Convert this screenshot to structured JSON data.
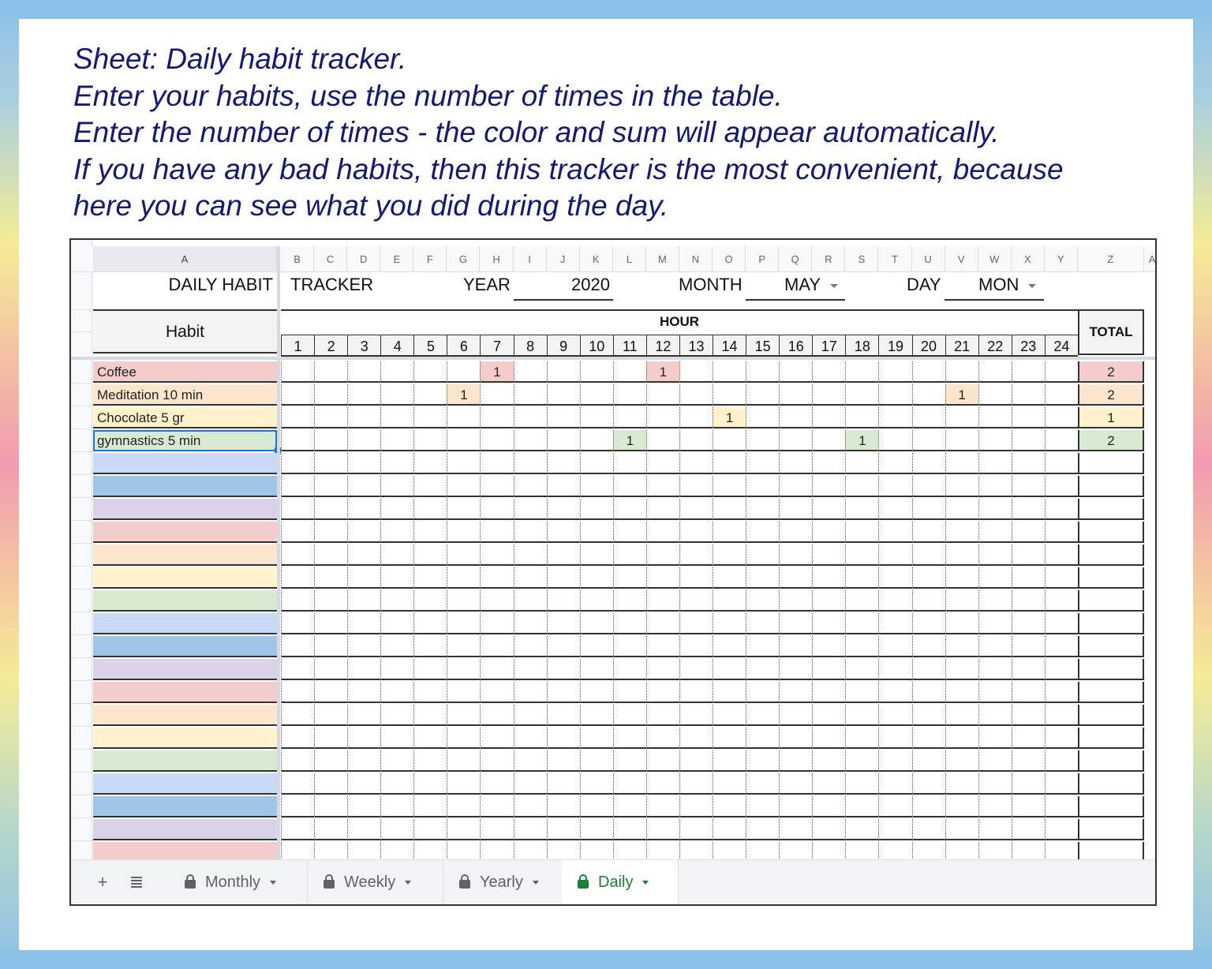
{
  "intro": {
    "lines": [
      "Sheet: Daily habit tracker.",
      "Enter your habits, use the number of times in the table.",
      "Enter the number of times - the color and sum will appear automatically.",
      "If you have any bad habits, then this tracker is the most convenient, because",
      "here you can see what you did during the day."
    ]
  },
  "columns": [
    "A",
    "B",
    "C",
    "D",
    "E",
    "F",
    "G",
    "H",
    "I",
    "J",
    "K",
    "L",
    "M",
    "N",
    "O",
    "P",
    "Q",
    "R",
    "S",
    "T",
    "U",
    "V",
    "W",
    "X",
    "Y",
    "Z",
    "AA"
  ],
  "header": {
    "title_left": "DAILY HABIT",
    "title_right": "TRACKER",
    "year_label": "YEAR",
    "year_value": "2020",
    "month_label": "MONTH",
    "month_value": "MAY",
    "day_label": "DAY",
    "day_value": "MON"
  },
  "table": {
    "habit_header": "Habit",
    "hour_header": "HOUR",
    "total_header": "TOTAL",
    "hours": [
      "1",
      "2",
      "3",
      "4",
      "5",
      "6",
      "7",
      "8",
      "9",
      "10",
      "11",
      "12",
      "13",
      "14",
      "15",
      "16",
      "17",
      "18",
      "19",
      "20",
      "21",
      "22",
      "23",
      "24"
    ],
    "habits": [
      {
        "name": "Coffee",
        "color": "#f4cccc",
        "marks": {
          "7": "1",
          "12": "1"
        },
        "total": "2"
      },
      {
        "name": "Meditation 10 min",
        "color": "#fce5cd",
        "marks": {
          "6": "1",
          "21": "1"
        },
        "total": "2"
      },
      {
        "name": "Chocolate 5 gr",
        "color": "#fff2cc",
        "marks": {
          "14": "1"
        },
        "total": "1"
      },
      {
        "name": "gymnastics 5 min",
        "color": "#d9ead3",
        "marks": {
          "11": "1",
          "18": "1"
        },
        "total": "2",
        "selected": true
      },
      {
        "name": "",
        "color": "#c9daf8"
      },
      {
        "name": "",
        "color": "#9fc5e8"
      },
      {
        "name": "",
        "color": "#d9d2e9"
      },
      {
        "name": "",
        "color": "#f4cccc"
      },
      {
        "name": "",
        "color": "#fce5cd"
      },
      {
        "name": "",
        "color": "#fff2cc"
      },
      {
        "name": "",
        "color": "#d9ead3"
      },
      {
        "name": "",
        "color": "#c9daf8"
      },
      {
        "name": "",
        "color": "#9fc5e8"
      },
      {
        "name": "",
        "color": "#d9d2e9"
      },
      {
        "name": "",
        "color": "#f4cccc"
      },
      {
        "name": "",
        "color": "#fce5cd"
      },
      {
        "name": "",
        "color": "#fff2cc"
      },
      {
        "name": "",
        "color": "#d9ead3"
      },
      {
        "name": "",
        "color": "#c9daf8"
      },
      {
        "name": "",
        "color": "#9fc5e8"
      },
      {
        "name": "",
        "color": "#d9d2e9"
      },
      {
        "name": "",
        "color": "#f4cccc"
      }
    ]
  },
  "tabbar": {
    "add_icon": "+",
    "list_icon": "≣",
    "tabs": [
      {
        "label": "Monthly",
        "active": false
      },
      {
        "label": "Weekly",
        "active": false
      },
      {
        "label": "Yearly",
        "active": false
      },
      {
        "label": "Daily",
        "active": true
      }
    ],
    "active_color": "#188038"
  }
}
